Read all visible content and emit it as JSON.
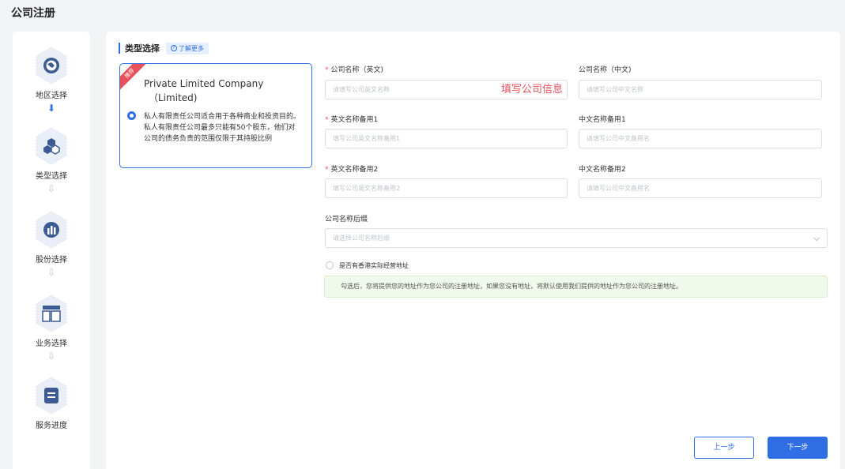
{
  "page": {
    "title": "公司注册"
  },
  "steps": [
    {
      "label": "地区选择",
      "icon": "globe-icon"
    },
    {
      "label": "类型选择",
      "icon": "hexagons-icon"
    },
    {
      "label": "股份选择",
      "icon": "chart-icon"
    },
    {
      "label": "业务选择",
      "icon": "layout-icon"
    },
    {
      "label": "服务进度",
      "icon": "document-icon"
    }
  ],
  "section": {
    "title": "类型选择",
    "learn_more": "了解更多"
  },
  "type_card": {
    "ribbon": "推荐",
    "title_line1": "Private Limited Company",
    "title_line2": "（Limited)",
    "description": "私人有限责任公司适合用于各种商业和投资目的。私人有限责任公司最多只能有50个股东，他们对公司的债务负责的范围仅限于其持股比例"
  },
  "form": {
    "name_en": {
      "label": "公司名称（英文)",
      "placeholder": "请填写公司英文名称",
      "overlay": "填写公司信息"
    },
    "name_cn": {
      "label": "公司名称（中文)",
      "placeholder": "请填写公司中文名称"
    },
    "alt_en_1": {
      "label": "英文名称备用1",
      "placeholder": "填写公司英文名称备用1"
    },
    "alt_cn_1": {
      "label": "中文名称备用1",
      "placeholder": "请填写公司中文备用名"
    },
    "alt_en_2": {
      "label": "英文名称备用2",
      "placeholder": "填写公司英文名称备用2"
    },
    "alt_cn_2": {
      "label": "中文名称备用2",
      "placeholder": "请填写公司中文备用名"
    },
    "suffix": {
      "label": "公司名称后缀",
      "placeholder": "请选择公司名称后缀"
    },
    "hk_address": {
      "label": "是否有香港实际经营地址"
    },
    "notice": "勾选后，您将提供您的地址作为您公司的注册地址，如果您没有地址，将默认使用我们提供的地址作为您公司的注册地址。"
  },
  "buttons": {
    "prev": "上一步",
    "next": "下一步"
  },
  "colors": {
    "primary": "#2f6ee5",
    "danger": "#e8505b",
    "notice_bg": "#f0f9eb"
  }
}
